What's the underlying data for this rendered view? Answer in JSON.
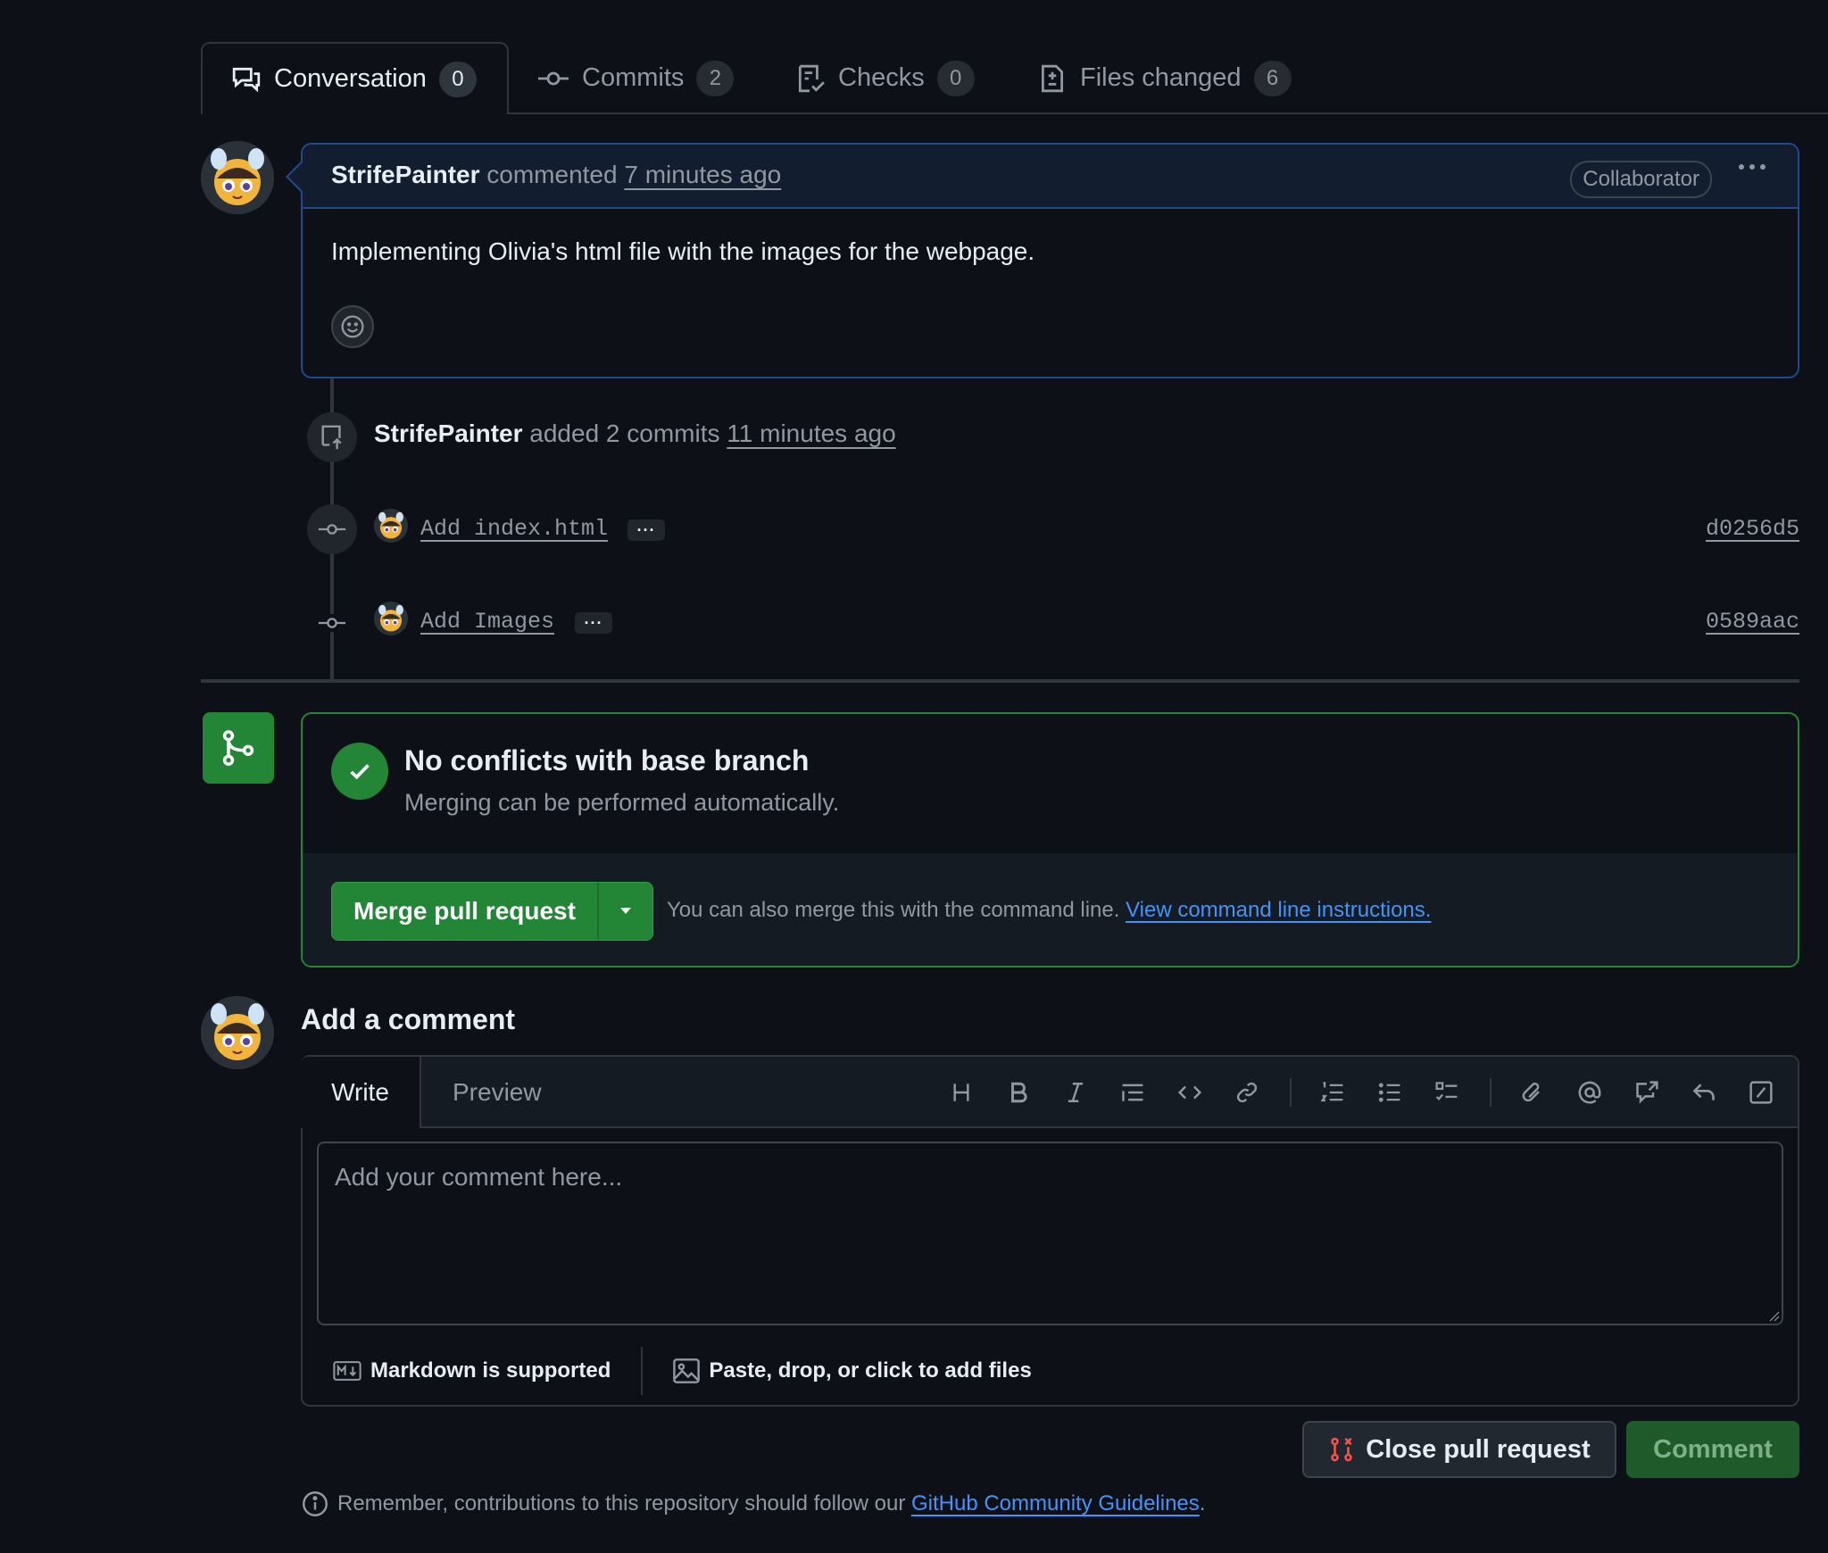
{
  "tabs": [
    {
      "label": "Conversation",
      "count": "0",
      "icon": "comment-discussion-icon"
    },
    {
      "label": "Commits",
      "count": "2",
      "icon": "git-commit-icon"
    },
    {
      "label": "Checks",
      "count": "0",
      "icon": "checklist-icon"
    },
    {
      "label": "Files changed",
      "count": "6",
      "icon": "file-diff-icon"
    }
  ],
  "comment": {
    "author": "StrifePainter",
    "action": "commented",
    "time": "7 minutes ago",
    "badge": "Collaborator",
    "body": "Implementing Olivia's html file with the images for the webpage."
  },
  "push_event": {
    "author": "StrifePainter",
    "action": "added 2 commits",
    "time": "11 minutes ago"
  },
  "commits": [
    {
      "message": "Add index.html",
      "sha": "d0256d5",
      "dots": "···"
    },
    {
      "message": "Add Images",
      "sha": "0589aac",
      "dots": "···"
    }
  ],
  "merge": {
    "title": "No conflicts with base branch",
    "subtitle": "Merging can be performed automatically.",
    "button": "Merge pull request",
    "hint": "You can also merge this with the command line.",
    "hint_link": "View command line instructions.",
    "accent": "#238636"
  },
  "add_comment": {
    "heading": "Add a comment",
    "tab_write": "Write",
    "tab_preview": "Preview",
    "placeholder": "Add your comment here...",
    "markdown_note": "Markdown is supported",
    "files_note": "Paste, drop, or click to add files",
    "toolbar_icons": [
      "heading-icon",
      "bold-icon",
      "italic-icon",
      "quote-icon",
      "code-icon",
      "link-icon",
      "ordered-list-icon",
      "unordered-list-icon",
      "task-list-icon",
      "attach-icon",
      "mention-icon",
      "cross-reference-icon",
      "reply-icon",
      "slash-command-icon"
    ]
  },
  "actions": {
    "close_label": "Close pull request",
    "comment_label": "Comment"
  },
  "footer": {
    "text": "Remember, contributions to this repository should follow our",
    "link": "GitHub Community Guidelines",
    "end": "."
  }
}
